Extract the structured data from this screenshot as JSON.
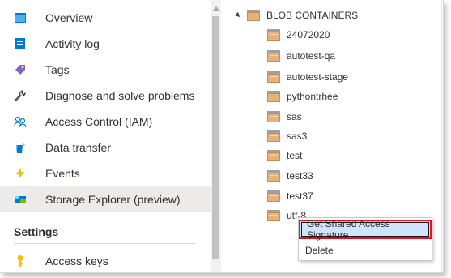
{
  "nav": {
    "items": [
      {
        "label": "Overview",
        "icon": "overview-icon"
      },
      {
        "label": "Activity log",
        "icon": "activity-log-icon"
      },
      {
        "label": "Tags",
        "icon": "tag-icon"
      },
      {
        "label": "Diagnose and solve problems",
        "icon": "wrench-icon"
      },
      {
        "label": "Access Control (IAM)",
        "icon": "people-icon"
      },
      {
        "label": "Data transfer",
        "icon": "data-transfer-icon"
      },
      {
        "label": "Events",
        "icon": "lightning-icon"
      },
      {
        "label": "Storage Explorer (preview)",
        "icon": "storage-explorer-icon"
      }
    ],
    "section_settings": "Settings",
    "access_keys": {
      "label": "Access keys",
      "icon": "key-icon"
    },
    "selected": "Storage Explorer (preview)"
  },
  "tree": {
    "root_label": "BLOB CONTAINERS",
    "items": [
      "24072020",
      "autotest-qa",
      "autotest-stage",
      "pythontrhee",
      "sas",
      "sas3",
      "test",
      "test33",
      "test37",
      "utf-8"
    ]
  },
  "context_menu": {
    "items": [
      "Get Shared Access Signature",
      "Delete"
    ],
    "highlighted": "Get Shared Access Signature"
  },
  "colors": {
    "selected_bg": "#edebe9",
    "menu_highlight": "#cfe3fb",
    "callout_border": "#e81123",
    "folder": "#e8b07a"
  }
}
